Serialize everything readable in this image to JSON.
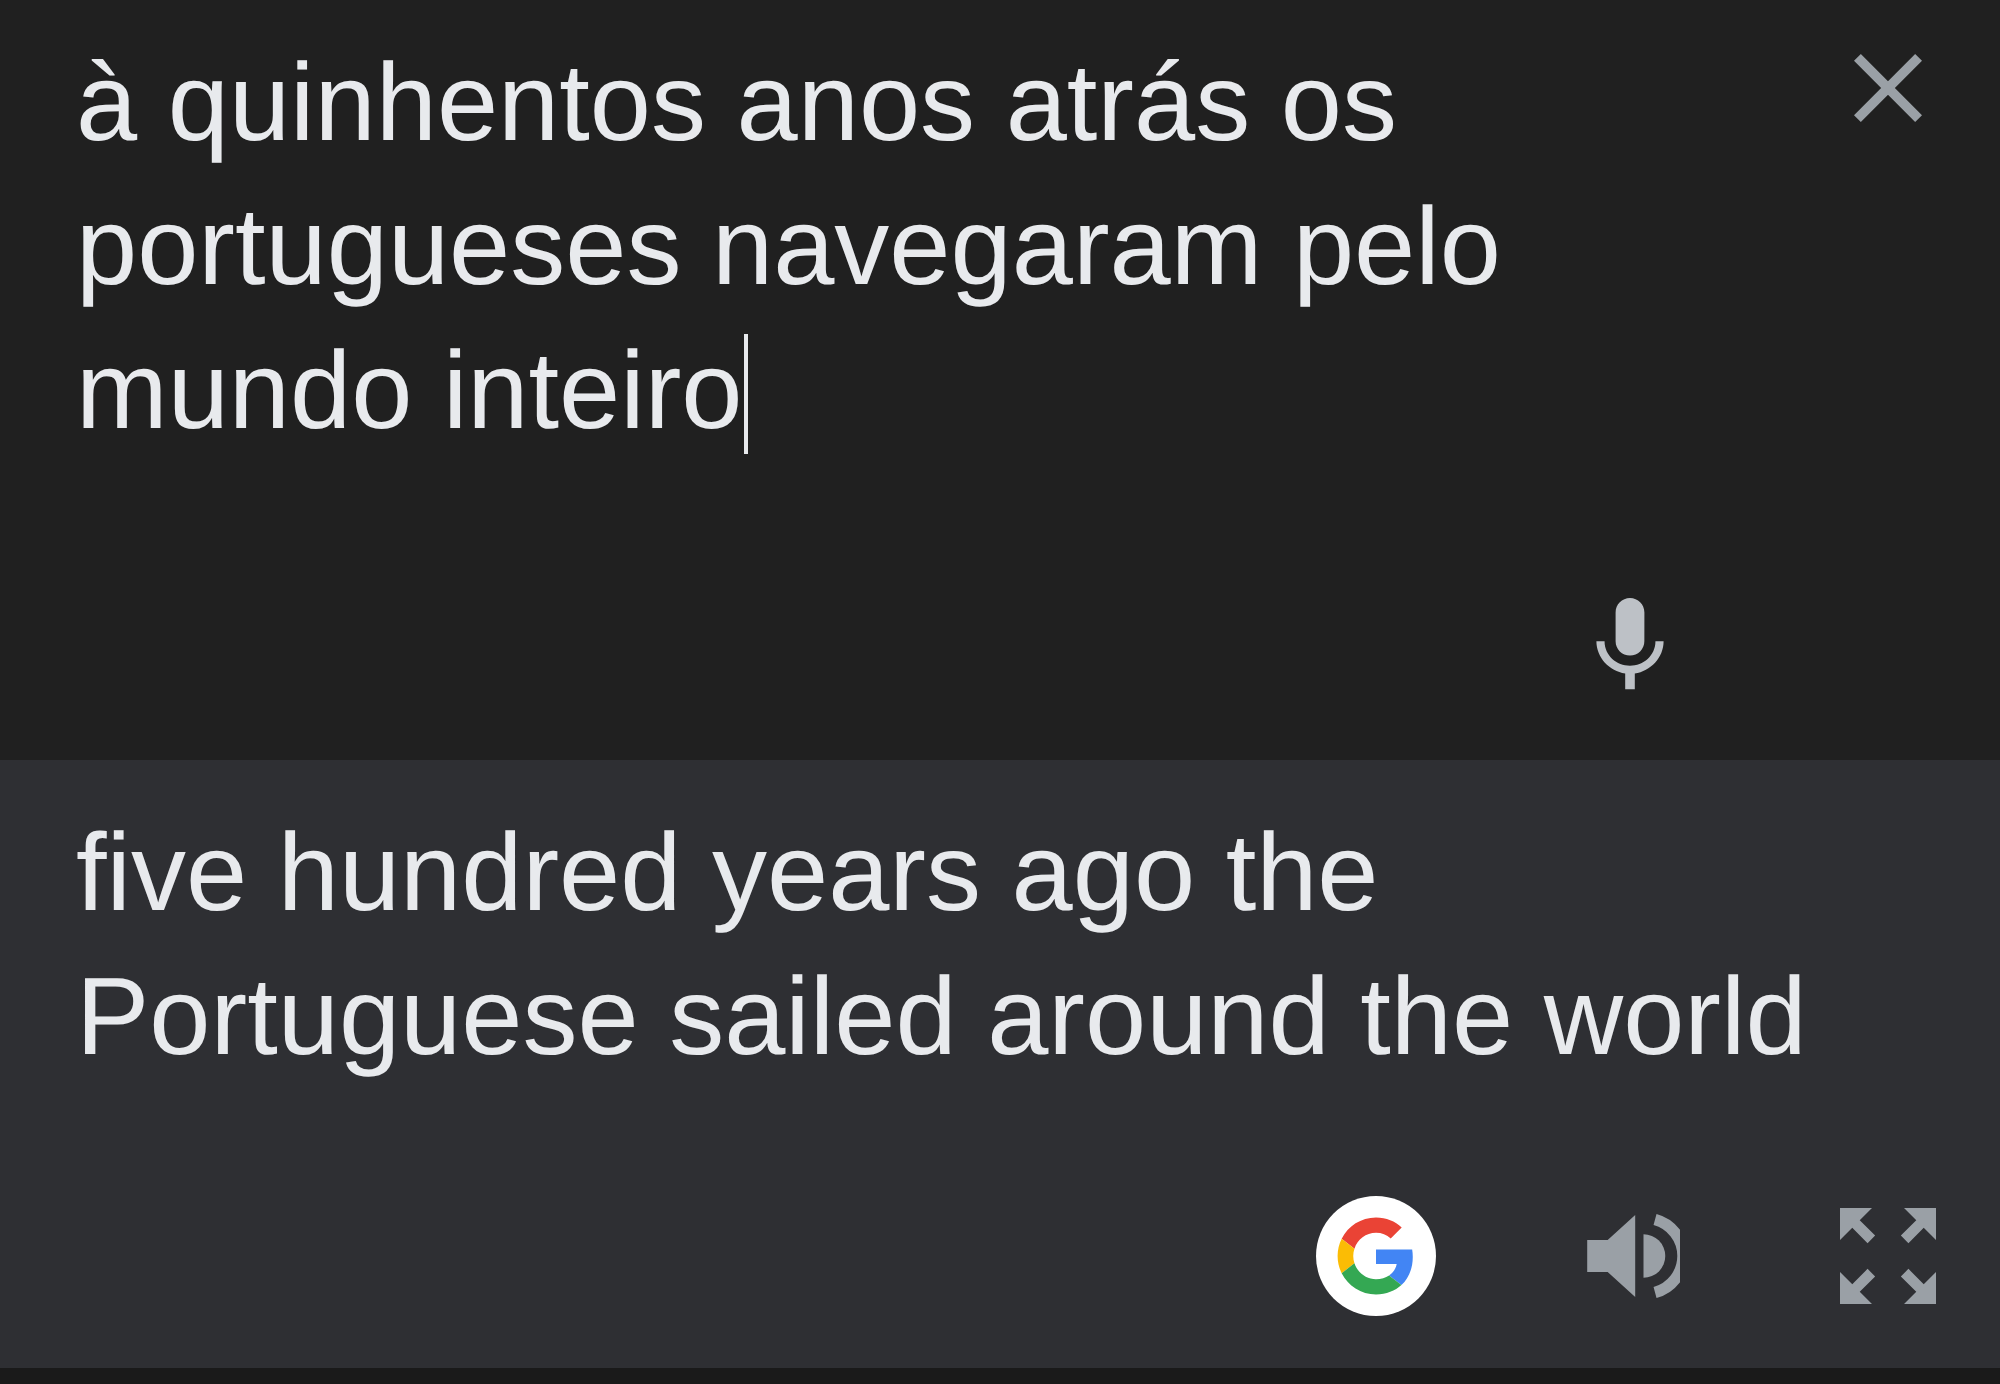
{
  "source": {
    "text": "à quinhentos anos atrás os portugueses navegaram pelo mundo inteiro",
    "focused": true
  },
  "translation": {
    "text": "five hundred years ago the Portuguese sailed around the world"
  }
}
